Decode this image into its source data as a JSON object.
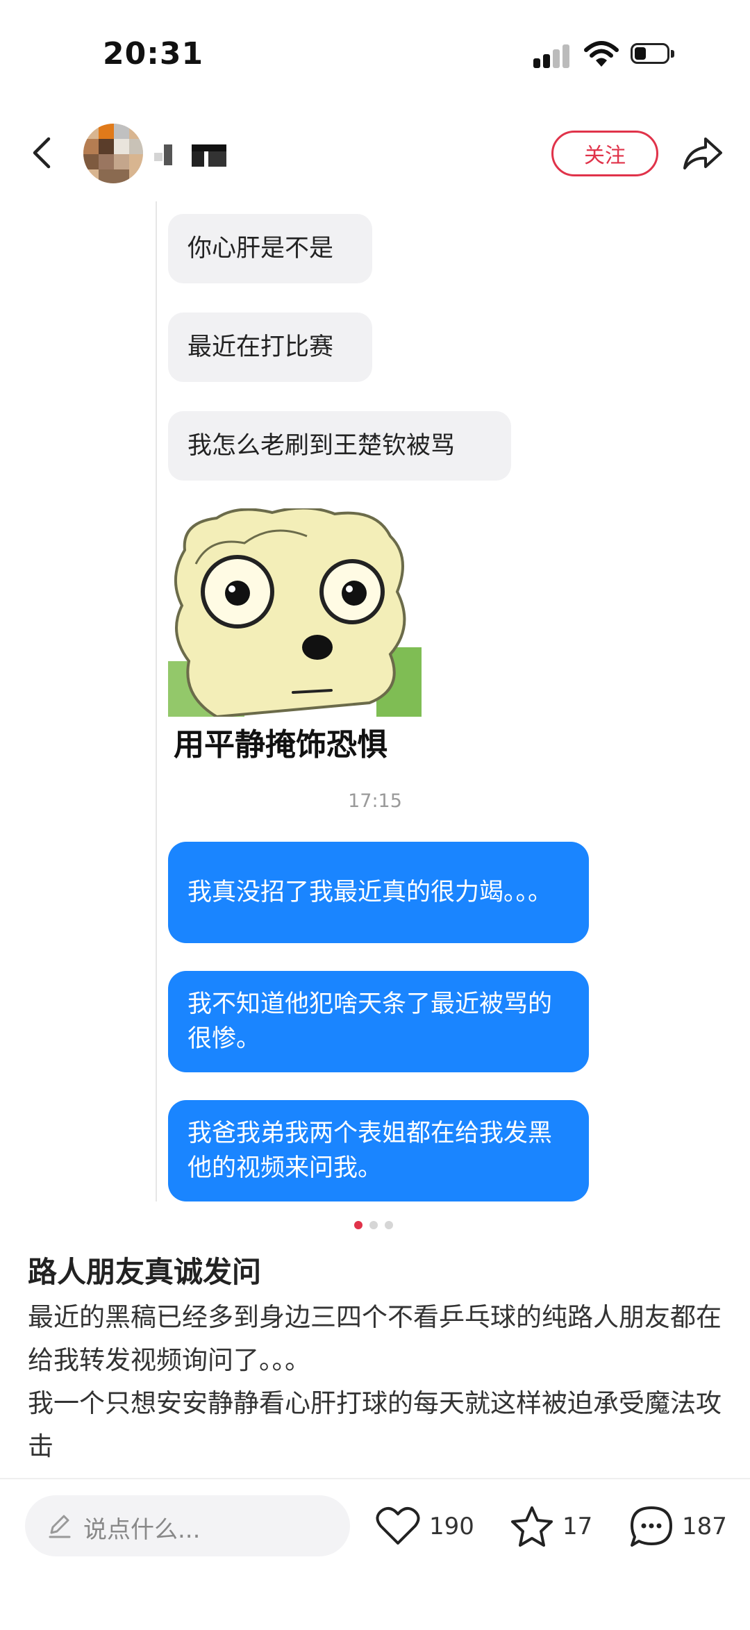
{
  "status_bar": {
    "time": "20:31"
  },
  "nav": {
    "follow_label": "关注"
  },
  "chat": {
    "messages_in": [
      "你心肝是不是",
      "最近在打比赛",
      "我怎么老刷到王楚钦被骂"
    ],
    "sticker_caption": "用平静掩饰恐惧",
    "timestamp": "17:15",
    "messages_out": [
      "我真没招了我最近真的很力竭。。。",
      "我不知道他犯啥天条了最近被骂的很惨。",
      "我爸我弟我两个表姐都在给我发黑他的视频来问我。"
    ]
  },
  "pagination": {
    "total": 3,
    "active": 1
  },
  "post": {
    "title": "路人朋友真诚发问",
    "body": [
      "最近的黑稿已经多到身边三四个不看乒乓球的纯路人朋友都在给我转发视频询问了。。。",
      "我一个只想安安静静看心肝打球的每天就这样被迫承受魔法攻击"
    ]
  },
  "bottom_bar": {
    "comment_placeholder": "说点什么...",
    "likes": "190",
    "collects": "17",
    "comments": "187"
  },
  "colors": {
    "accent": "#e0334a",
    "bubble_out": "#1a85ff",
    "bubble_in": "#f1f1f3"
  }
}
